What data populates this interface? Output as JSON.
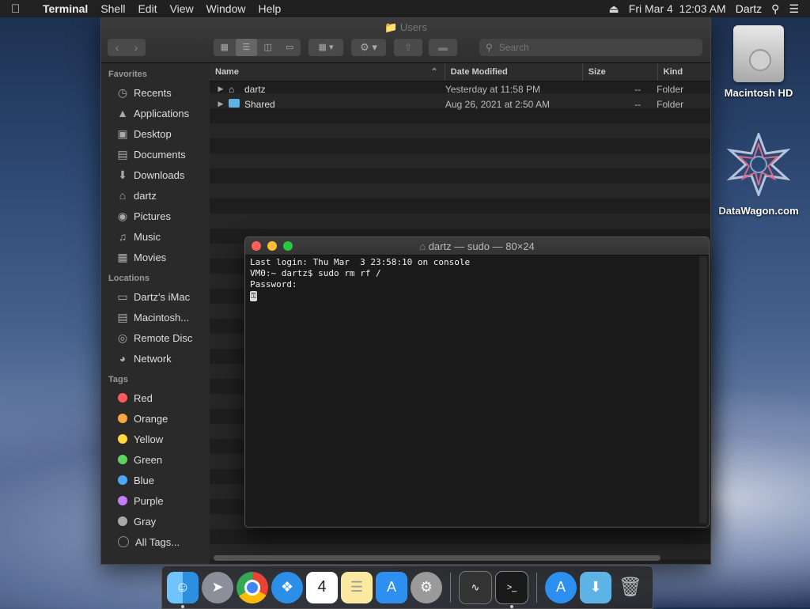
{
  "menubar": {
    "app_name": "Terminal",
    "menus": [
      "Shell",
      "Edit",
      "View",
      "Window",
      "Help"
    ],
    "date_time": "Fri Mar 4  12:03 AM",
    "user": "Dartz"
  },
  "desktop": {
    "icons": [
      {
        "label": "Macintosh HD"
      },
      {
        "label": "DataWagon.com"
      }
    ]
  },
  "finder": {
    "title": "Users",
    "search_placeholder": "Search",
    "sidebar": {
      "favorites_heading": "Favorites",
      "favorites": [
        "Recents",
        "Applications",
        "Desktop",
        "Documents",
        "Downloads",
        "dartz",
        "Pictures",
        "Music",
        "Movies"
      ],
      "locations_heading": "Locations",
      "locations": [
        "Dartz's iMac",
        "Macintosh...",
        "Remote Disc",
        "Network"
      ],
      "tags_heading": "Tags",
      "tags": [
        {
          "label": "Red",
          "color": "#ff5b5b"
        },
        {
          "label": "Orange",
          "color": "#ffa63d"
        },
        {
          "label": "Yellow",
          "color": "#ffd93d"
        },
        {
          "label": "Green",
          "color": "#5ed35e"
        },
        {
          "label": "Blue",
          "color": "#4aa8ff"
        },
        {
          "label": "Purple",
          "color": "#c77dff"
        },
        {
          "label": "Gray",
          "color": "#a8a8a8"
        }
      ],
      "all_tags": "All Tags..."
    },
    "columns": {
      "name": "Name",
      "date": "Date Modified",
      "size": "Size",
      "kind": "Kind"
    },
    "rows": [
      {
        "name": "dartz",
        "date": "Yesterday at 11:58 PM",
        "size": "--",
        "kind": "Folder"
      },
      {
        "name": "Shared",
        "date": "Aug 26, 2021 at 2:50 AM",
        "size": "--",
        "kind": "Folder"
      }
    ]
  },
  "terminal": {
    "title": "dartz — sudo — 80×24",
    "lines": [
      "Last login: Thu Mar  3 23:58:10 on console",
      "VM0:~ dartz$ sudo rm rf /",
      "Password:"
    ]
  }
}
